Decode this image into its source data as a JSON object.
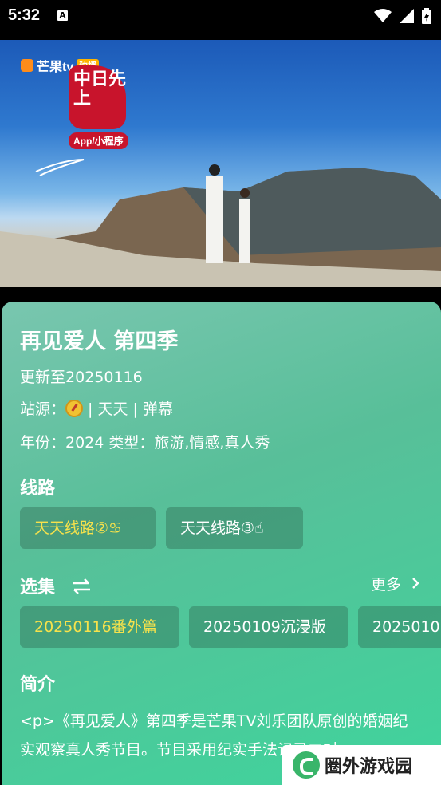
{
  "status": {
    "time": "5:32",
    "a_badge": "A"
  },
  "video": {
    "logo_text": "芒果tv",
    "logo_live": "独播",
    "badge_text": "中日先上",
    "badge_app": "App/小程序"
  },
  "show": {
    "title": "再见爱人 第四季",
    "update": "更新至20250116",
    "source_label": "站源：",
    "source_parts": "| 天天 | 弹幕",
    "year_line": "年份：2024  类型：旅游,情感,真人秀"
  },
  "routes": {
    "heading": "线路",
    "items": [
      "天天线路②♋",
      "天天线路③☝"
    ]
  },
  "episodes": {
    "heading": "选集",
    "more": "更多",
    "items": [
      "20250116番外篇",
      "20250109沉浸版",
      "2025010"
    ]
  },
  "intro": {
    "heading": "简介",
    "text": "<p>《再见爱人》第四季是芒果TV刘乐团队原创的婚姻纪实观察真人秀节目。节目采用纪实手法记录三对"
  },
  "watermark": {
    "text": "圈外游戏园"
  }
}
